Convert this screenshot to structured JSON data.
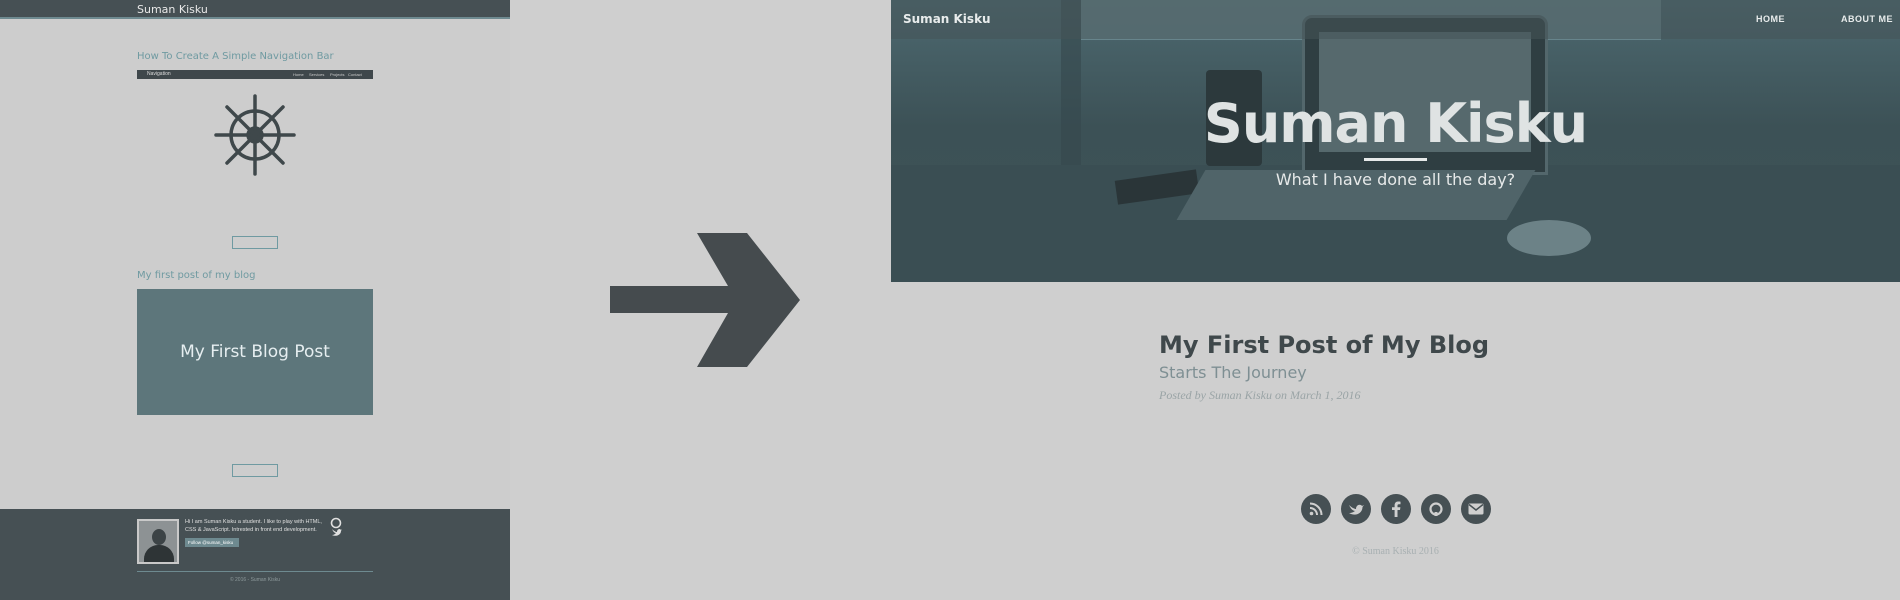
{
  "old_site": {
    "brand": "Suman Kisku",
    "post1": {
      "date": "",
      "title": "How To Create A Simple Navigation Bar",
      "nav_brand": "Navigation",
      "nav_links": [
        "Home",
        "Services",
        "Projects",
        "Contact"
      ],
      "excerpt": "",
      "button": ""
    },
    "post2": {
      "date": "",
      "title": "My first post of my blog",
      "image_text": "My First Blog Post",
      "excerpt": "",
      "button": ""
    },
    "footer": {
      "bio": "Hi I am Suman Kisku a student. I like to play with HTML, CSS & JavaScript. Intrested in front end development.",
      "follow": "Follow @suman_kisku",
      "copyright": "© 2016 - Suman Kisku"
    }
  },
  "new_site": {
    "brand": "Suman Kisku",
    "nav": [
      "HOME",
      "ABOUT ME"
    ],
    "hero": {
      "title": "Suman Kisku",
      "subtitle": "What I have done all the day?"
    },
    "post": {
      "title": "My First Post of My Blog",
      "subtitle": "Starts The Journey",
      "meta": "Posted by Suman Kisku on March 1, 2016"
    },
    "social_icons": [
      "rss-icon",
      "twitter-icon",
      "facebook-icon",
      "github-icon",
      "email-icon"
    ],
    "copyright": "© Suman Kisku 2016"
  }
}
